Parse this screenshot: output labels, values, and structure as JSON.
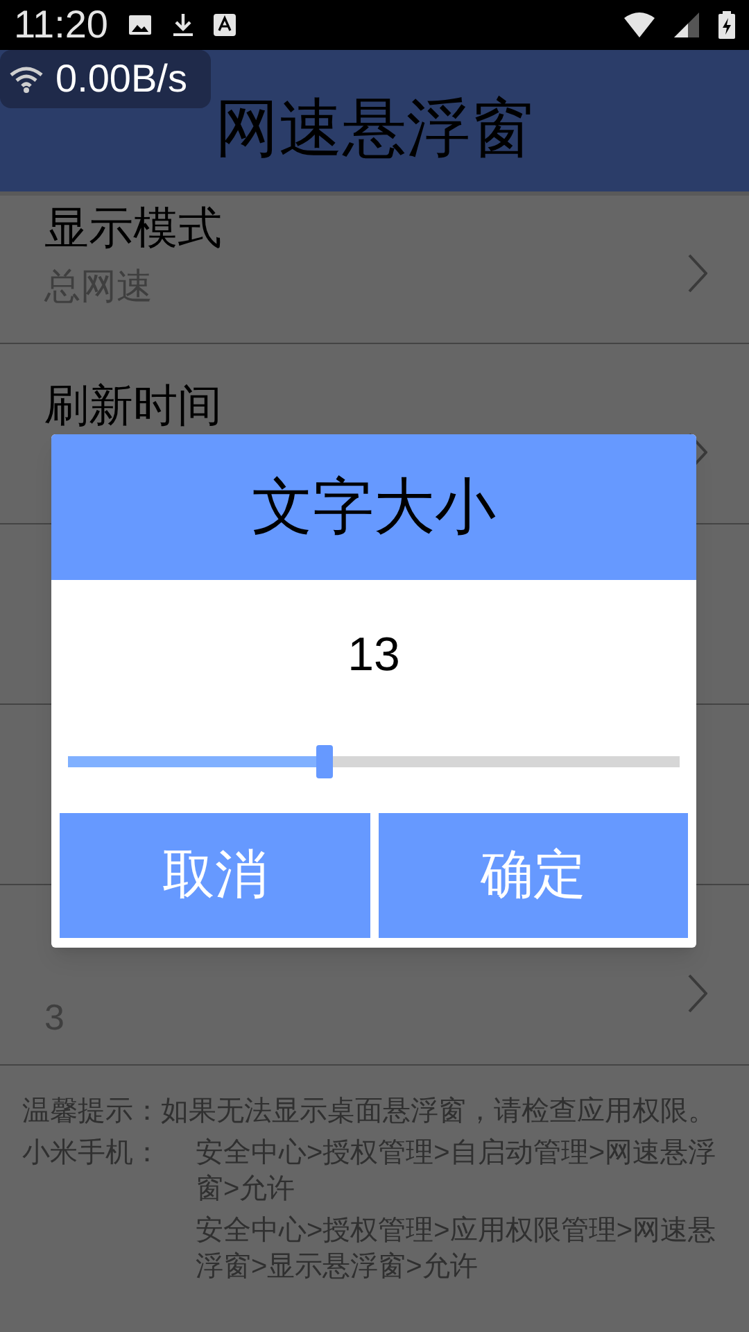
{
  "status_bar": {
    "time": "11:20"
  },
  "speed_overlay": {
    "text": "0.00B/s"
  },
  "app_bar": {
    "title": "网速悬浮窗"
  },
  "settings": [
    {
      "kind": "setting",
      "title": "显示模式",
      "value": "总网速"
    },
    {
      "kind": "setting",
      "title": "刷新时间"
    },
    {
      "kind": "covered"
    },
    {
      "kind": "covered"
    },
    {
      "kind": "value_only",
      "value": "3"
    }
  ],
  "notes": [
    {
      "kind": "paragraph",
      "text": "温馨提示：如果无法显示桌面悬浮窗，请检查应用权限。"
    },
    {
      "kind": "steps",
      "label": "小米手机：",
      "steps": [
        "安全中心>授权管理>自启动管理>网速悬浮窗>允许",
        "安全中心>授权管理>应用权限管理>网速悬浮窗>显示悬浮窗>允许"
      ]
    }
  ],
  "dialog": {
    "title": "文字大小",
    "value": "13",
    "slider": {
      "level": 0.42
    },
    "buttons": [
      {
        "label": "取消"
      },
      {
        "label": "确定"
      }
    ]
  }
}
